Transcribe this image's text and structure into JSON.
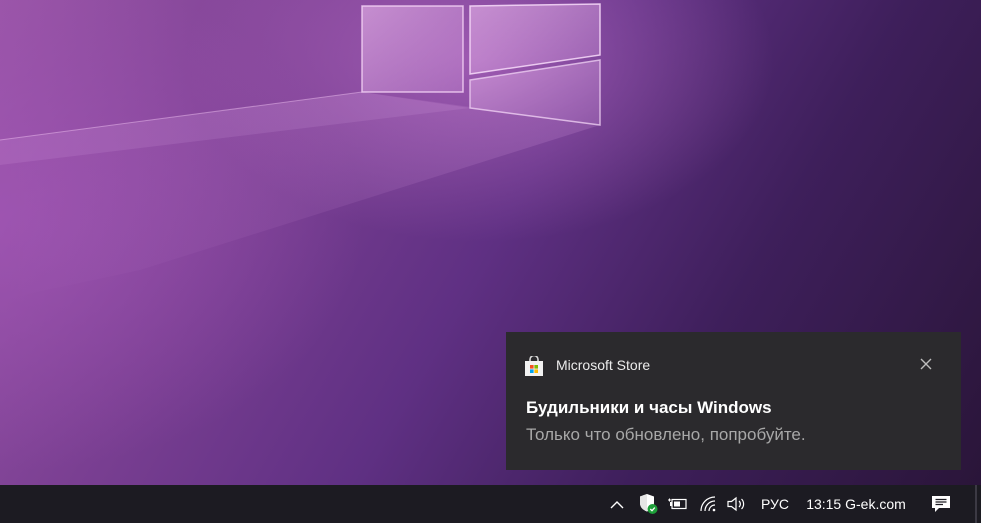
{
  "notification": {
    "app_name": "Microsoft Store",
    "app_icon": "store-bag-icon",
    "close_icon": "close-icon",
    "title": "Будильники и часы Windows",
    "body": "Только что обновлено, попробуйте."
  },
  "taskbar": {
    "tray_icons": [
      "chevron-up-icon",
      "shield-icon",
      "battery-icon",
      "wifi-icon",
      "volume-icon"
    ],
    "language": "РУС",
    "clock": "13:15 G-ek.com",
    "notifications_icon": "action-center-icon"
  },
  "colors": {
    "toast_background": "#2b2a2d",
    "taskbar_background": "#1c1b22",
    "wallpaper_primary": "#7a3f92",
    "wallpaper_dark": "#2a1539",
    "shield_check": "#1e9f3a"
  }
}
